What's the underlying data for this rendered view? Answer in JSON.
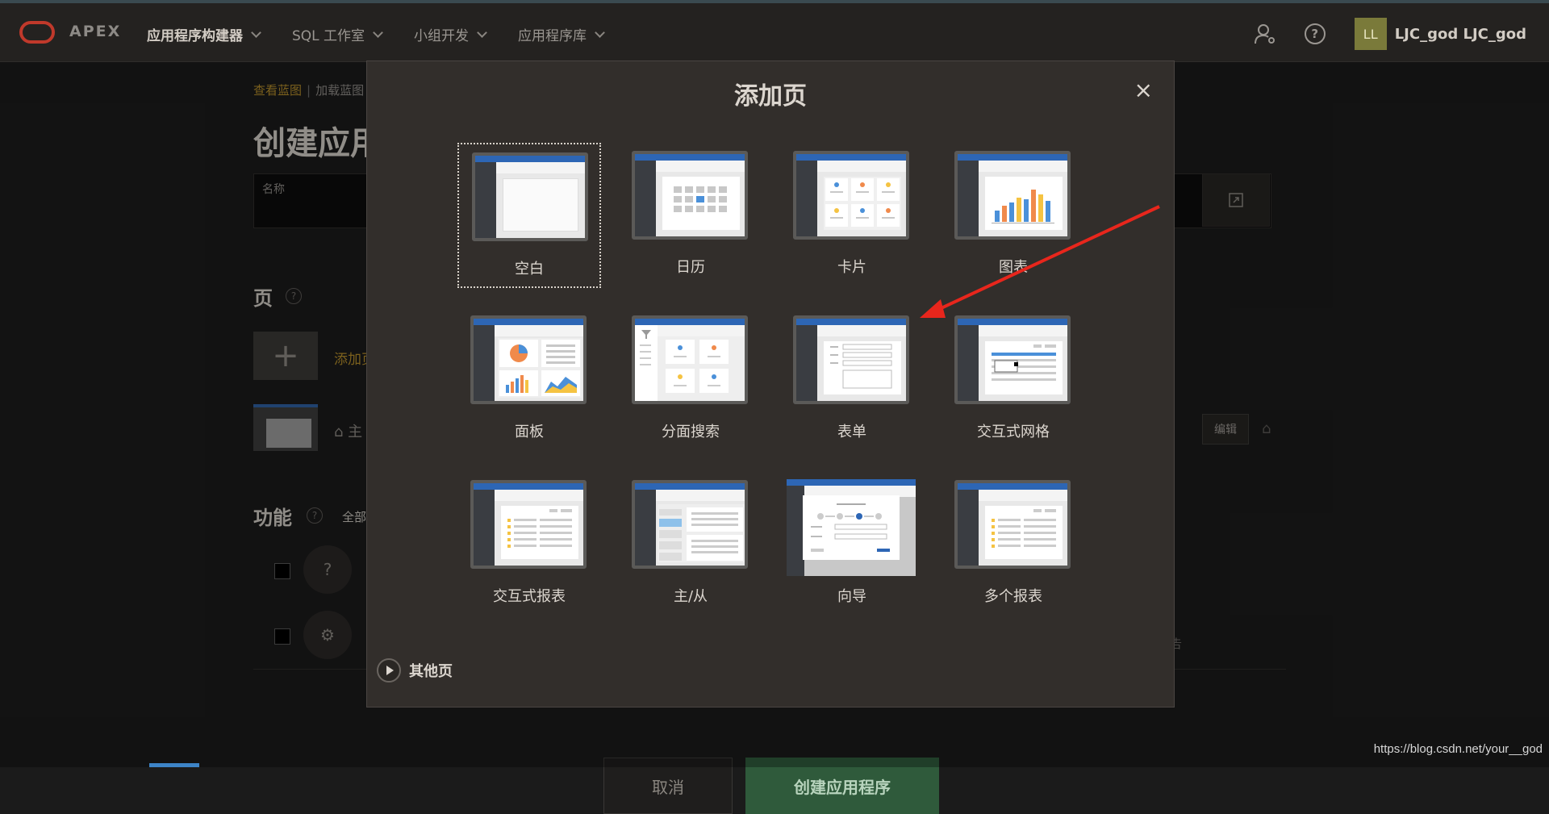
{
  "navbar": {
    "brand": "APEX",
    "menu": [
      {
        "label": "应用程序构建器"
      },
      {
        "label": "SQL 工作室"
      },
      {
        "label": "小组开发"
      },
      {
        "label": "应用程序库"
      }
    ],
    "user_initials": "LL",
    "user_name": "LJC_god LJC_god"
  },
  "background": {
    "breadcrumb": {
      "link": "查看蓝图",
      "item": "加载蓝图"
    },
    "title": "创建应用",
    "name_label": "名称",
    "pages_section": "页",
    "add_page_label": "添加页",
    "home_label": "主",
    "edit_label": "编辑",
    "features_section": "功能",
    "all_label": "全部",
    "report_fragment": "告",
    "cancel_label": "取消",
    "create_label": "创建应用程序"
  },
  "dialog": {
    "title": "添加页",
    "close": "×",
    "tiles": [
      {
        "label": "空白",
        "icon": "blank-page-icon",
        "selected": true
      },
      {
        "label": "日历",
        "icon": "calendar-page-icon"
      },
      {
        "label": "卡片",
        "icon": "cards-page-icon"
      },
      {
        "label": "图表",
        "icon": "chart-page-icon"
      },
      {
        "label": "面板",
        "icon": "dashboard-page-icon"
      },
      {
        "label": "分面搜索",
        "icon": "faceted-search-page-icon"
      },
      {
        "label": "表单",
        "icon": "form-page-icon"
      },
      {
        "label": "交互式网格",
        "icon": "interactive-grid-page-icon"
      },
      {
        "label": "交互式报表",
        "icon": "interactive-report-page-icon"
      },
      {
        "label": "主/从",
        "icon": "master-detail-page-icon"
      },
      {
        "label": "向导",
        "icon": "wizard-page-icon"
      },
      {
        "label": "多个报表",
        "icon": "multiple-reports-page-icon"
      }
    ],
    "other_pages": "其他页"
  },
  "watermark": "https://blog.csdn.net/your__god",
  "colors": {
    "accent_gold": "#b08a2a",
    "primary_green": "#2f5a3b",
    "thumb_blue": "#2d66b5",
    "annotation_arrow": "#e8261c"
  }
}
